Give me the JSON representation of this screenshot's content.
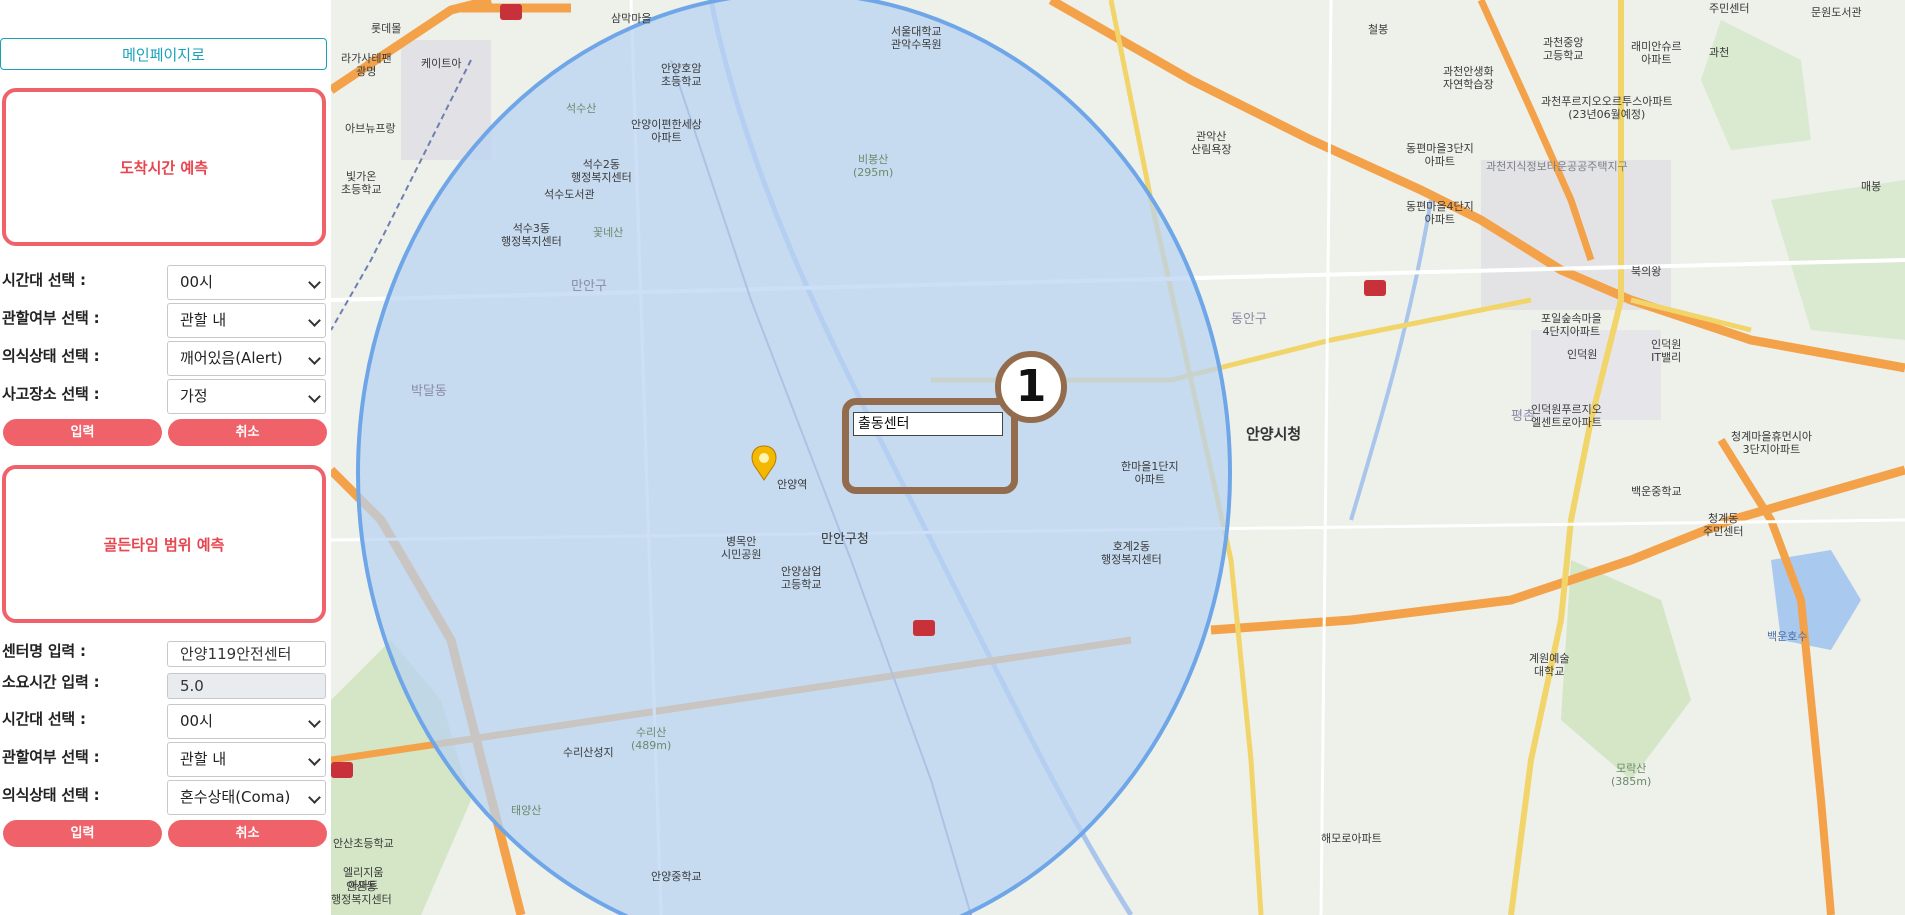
{
  "sidebar": {
    "main_link": "메인페이지로",
    "arrival_prediction": {
      "title": "도착시간 예측",
      "fields": [
        {
          "label": "시간대 선택 :",
          "value": "00시"
        },
        {
          "label": "관할여부 선택 :",
          "value": "관할 내"
        },
        {
          "label": "의식상태 선택 :",
          "value": "깨어있음(Alert)"
        },
        {
          "label": "사고장소 선택 :",
          "value": "가정"
        }
      ],
      "submit": "입력",
      "cancel": "취소"
    },
    "golden_time": {
      "title": "골든타임 범위 예측",
      "center_name_label": "센터명 입력 :",
      "center_name_value": "안양119안전센터",
      "duration_label": "소요시간 입력 :",
      "duration_value": "5.0",
      "fields": [
        {
          "label": "시간대 선택 :",
          "value": "00시"
        },
        {
          "label": "관할여부 선택 :",
          "value": "관할 내"
        },
        {
          "label": "의식상태 선택 :",
          "value": "혼수상태(Coma)"
        }
      ],
      "submit": "입력",
      "cancel": "취소"
    }
  },
  "map": {
    "marker_label": "출동센터",
    "badge_number": "1",
    "colors": {
      "radius_fill": "#b9d3f2",
      "radius_stroke": "#6fa6e8",
      "highway": "#f4a24a",
      "marker_box": "#936c4d",
      "button_red": "#f0626a"
    },
    "labels": {
      "lotte_mart": "롯데몰",
      "lagasa": "라가사테팬\n광명",
      "kaetelea": "케이트아",
      "abnupark": "아브뉴프랑",
      "bitgaon": "빛가온\n초등학교",
      "seoksu": "석수산",
      "sansang": "삼막마을",
      "anyang_elem": "안양호암\n초등학교",
      "anyang_apt": "안양이편한세상\n아파트",
      "seoksu2": "석수2동\n행정복지센터",
      "seoksu3": "석수3동\n행정복지센터",
      "kkotnaesan": "꽃네산",
      "seoksu_stn": "석수도서관",
      "biseong": "비봉산\n(295m)",
      "seoul_univ": "서울대학교\n관악수목원",
      "cheolbang": "철봉",
      "gwacheon_nat": "과천안생화\n자연학습장",
      "gwacheon_high": "과천중앙\n고등학교",
      "gwacheon_prugio": "과천푸르지오오르투스아파트\n(23년06월예정)",
      "raemian": "래미안슈르\n아파트",
      "gwacheon_ic": "과천",
      "juminc": "주민센터",
      "munwon": "문원도서관",
      "dongpyeon": "동편마을3단지\n아파트",
      "gwacheon_ji": "과천지식정보타운공공주택지구",
      "dongpyeon4": "동편마을4단지\n아파트",
      "maebong": "매봉",
      "ui_wang": "북의왕",
      "manan": "만안구",
      "anyang_city": "안양시청",
      "bak": "박달동",
      "dong_an": "동안구",
      "anyang_stn": "안양역",
      "anyang_cheong": "만안구청",
      "hanmaeul": "한마을1단지\n아파트",
      "hogye": "호계2동\n행정복지센터",
      "anyang_high": "안양삼업\n고등학교",
      "suri": "수리산\n(489m)",
      "surisan": "수리산성지",
      "taeyang": "태양산",
      "anyang_middle": "안양중학교",
      "byeong": "병목안\n시민공원",
      "pyeongchon": "평촌",
      "inderwon": "인덕원",
      "inderwon_apt": "인덕원푸르지오\n엘센트로아파트",
      "cheonggye": "청계마을휴먼시아\n3단지아파트",
      "baekun": "백운호수",
      "baekun_middle": "백운중학교",
      "gyewon": "계원예술\n대학교",
      "moraksan": "모락산\n(385m)",
      "haemoro": "해모로아파트",
      "gwanak": "관악산\n산림욕장",
      "pogil": "포일숲속마을\n4단지아파트",
      "uiwang_it": "인덕원\nIT밸리",
      "cheonggye_center": "청계동\n주민센터",
      "anyang_elem2": "안산초등학교",
      "elli": "엘리지움\n아파트",
      "ansan_center": "안산동\n행정복지센터"
    }
  }
}
